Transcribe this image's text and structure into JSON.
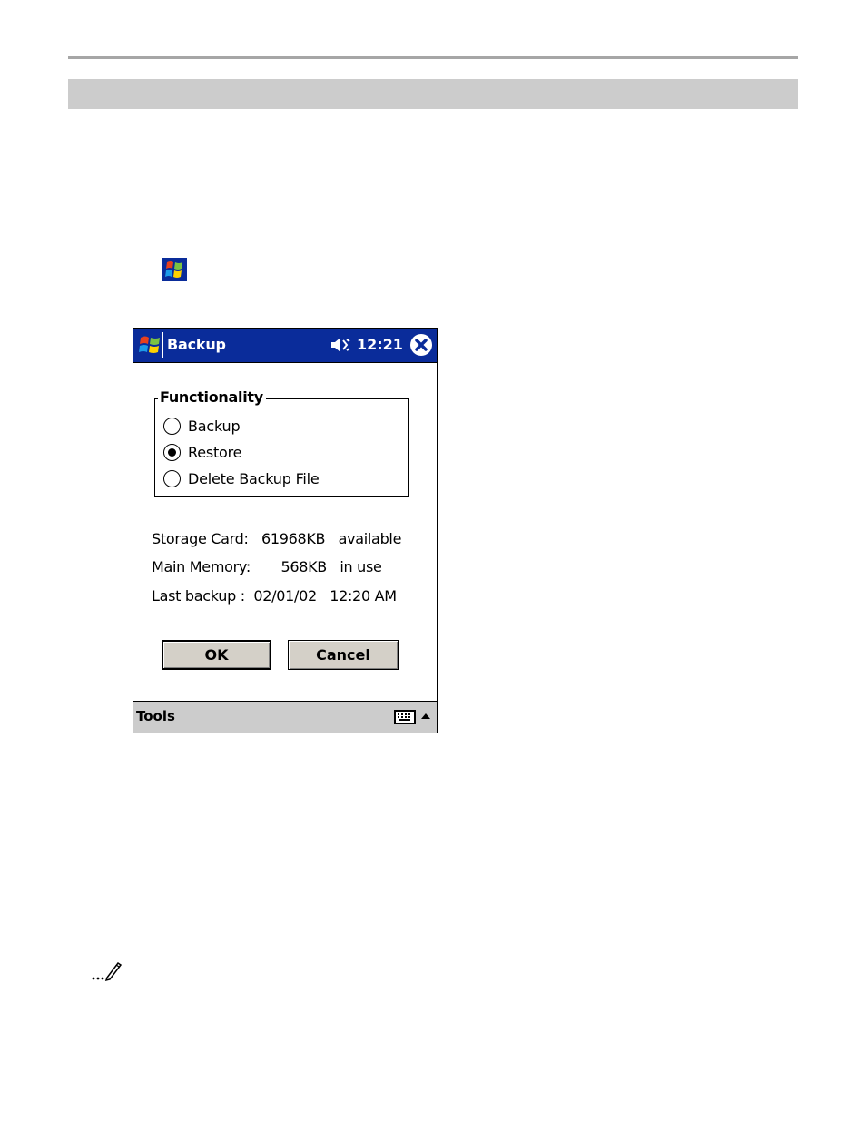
{
  "app": {
    "title": "Backup",
    "clock": "12:21"
  },
  "group": {
    "label": "Functionality",
    "options": [
      {
        "label": "Backup",
        "selected": false
      },
      {
        "label": "Restore",
        "selected": true
      },
      {
        "label": "Delete Backup File",
        "selected": false
      }
    ]
  },
  "info": {
    "storage_card": "Storage Card:   61968KB   available",
    "main_memory": "Main Memory:       568KB   in use",
    "last_backup": "Last backup :  02/01/02   12:20 AM"
  },
  "buttons": {
    "ok": "OK",
    "cancel": "Cancel"
  },
  "menubar": {
    "tools": "Tools"
  },
  "icons": {
    "start": "windows-flag-icon",
    "speaker": "speaker-muted-icon",
    "close": "close-circle-icon",
    "keyboard": "keyboard-icon",
    "sip_arrow": "up-arrow-icon",
    "note": "pencil-note-icon"
  },
  "colors": {
    "titlebar": "#0a2c9a",
    "menubar": "#cccccc",
    "button_face": "#d4d0c8",
    "page_band": "#cccccc"
  }
}
